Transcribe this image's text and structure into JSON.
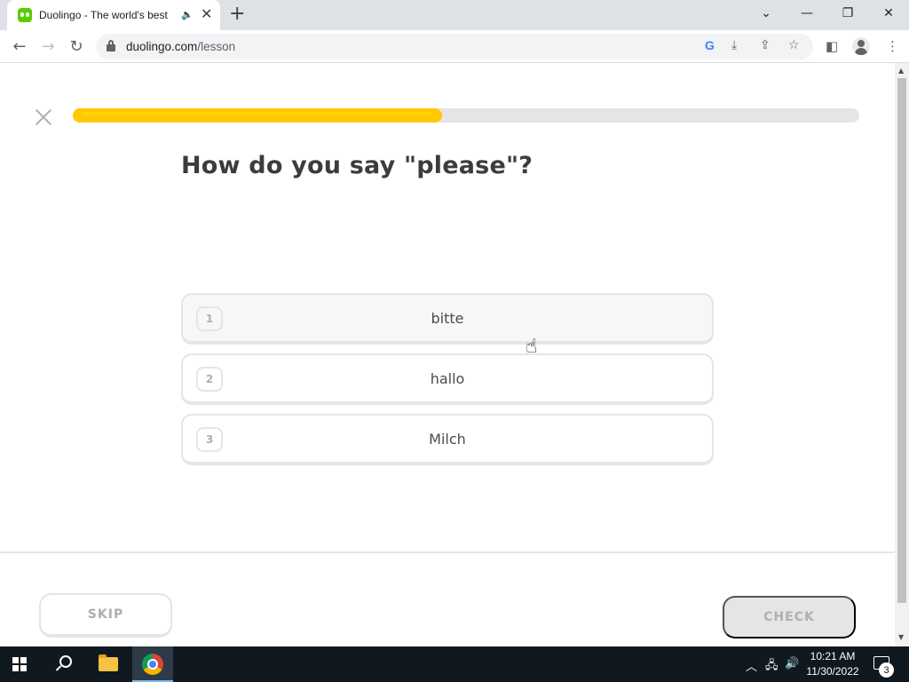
{
  "browser": {
    "tab_title": "Duolingo - The world's best",
    "tab_close_glyph": "✕",
    "new_tab_glyph": "+",
    "url_host": "duolingo.com",
    "url_path": "/lesson"
  },
  "lesson": {
    "progress_fraction": 0.47,
    "question": "How do you say \"please\"?",
    "choices": [
      {
        "key": "1",
        "text": "bitte"
      },
      {
        "key": "2",
        "text": "hallo"
      },
      {
        "key": "3",
        "text": "Milch"
      }
    ],
    "skip_label": "SKIP",
    "check_label": "CHECK"
  },
  "taskbar": {
    "time": "10:21 AM",
    "date": "11/30/2022",
    "notification_count": "3"
  },
  "colors": {
    "progress_fill": "#ffc800",
    "brand_green": "#58cc02"
  },
  "icons": {
    "back": "back-arrow-icon",
    "forward": "forward-arrow-icon",
    "reload": "reload-icon",
    "close_lesson": "close-icon"
  }
}
